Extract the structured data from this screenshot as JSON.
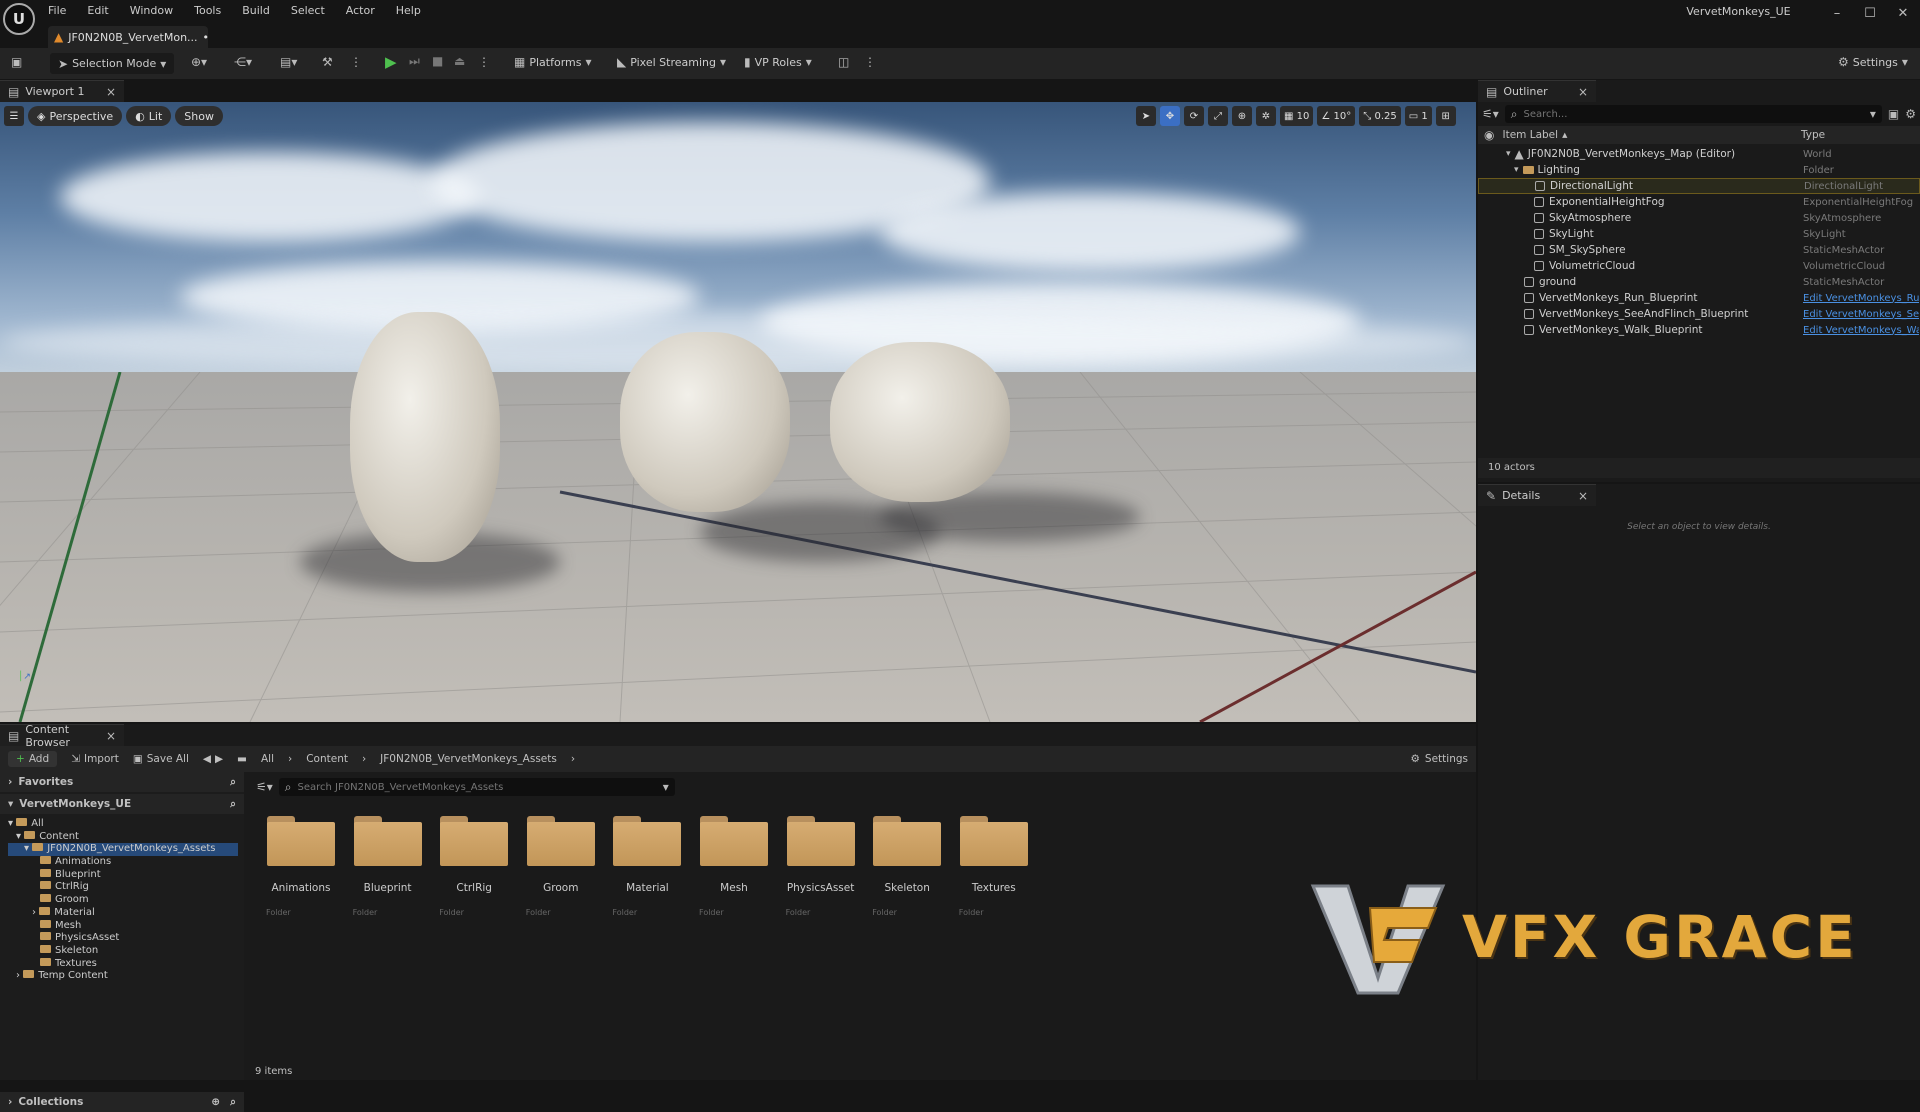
{
  "app": {
    "window_title": "VervetMonkeys_UE",
    "logo": "U",
    "doc_tab": "JF0N2N0B_VervetMon...",
    "doc_tab_dot": "•"
  },
  "menu": [
    "File",
    "Edit",
    "Window",
    "Tools",
    "Build",
    "Select",
    "Actor",
    "Help"
  ],
  "toolbar": {
    "selection_mode": "Selection Mode",
    "platforms": "Platforms",
    "pixel_streaming": "Pixel Streaming",
    "vp_roles": "VP Roles",
    "settings": "Settings"
  },
  "viewport": {
    "tab": "Viewport 1",
    "perspective": "Perspective",
    "lit": "Lit",
    "show": "Show",
    "grid_snap": "10",
    "rot_snap": "10°",
    "scale_snap": "0.25",
    "cam_speed": "1"
  },
  "outliner": {
    "tab": "Outliner",
    "search_placeholder": "Search...",
    "col_label": "Item Label",
    "col_type": "Type",
    "actor_count": "10 actors",
    "rows": [
      {
        "label": "JF0N2N0B_VervetMonkeys_Map (Editor)",
        "type": "World"
      },
      {
        "label": "Lighting",
        "type": "Folder"
      },
      {
        "label": "DirectionalLight",
        "type": "DirectionalLight"
      },
      {
        "label": "ExponentialHeightFog",
        "type": "ExponentialHeightFog"
      },
      {
        "label": "SkyAtmosphere",
        "type": "SkyAtmosphere"
      },
      {
        "label": "SkyLight",
        "type": "SkyLight"
      },
      {
        "label": "SM_SkySphere",
        "type": "StaticMeshActor"
      },
      {
        "label": "VolumetricCloud",
        "type": "VolumetricCloud"
      },
      {
        "label": "ground",
        "type": "StaticMeshActor"
      },
      {
        "label": "VervetMonkeys_Run_Blueprint",
        "type": "Edit VervetMonkeys_Rur"
      },
      {
        "label": "VervetMonkeys_SeeAndFlinch_Blueprint",
        "type": "Edit VervetMonkeys_See"
      },
      {
        "label": "VervetMonkeys_Walk_Blueprint",
        "type": "Edit VervetMonkeys_Wal"
      }
    ]
  },
  "details": {
    "tab": "Details",
    "empty_text": "Select an object to view details."
  },
  "content_browser": {
    "tab": "Content Browser",
    "add": "Add",
    "import": "Import",
    "save_all": "Save All",
    "crumb_all": "All",
    "crumb_content": "Content",
    "crumb_assets": "JF0N2N0B_VervetMonkeys_Assets",
    "settings": "Settings",
    "favorites": "Favorites",
    "project": "VervetMonkeys_UE",
    "collections": "Collections",
    "search_placeholder": "Search JF0N2N0B_VervetMonkeys_Assets",
    "item_count": "9 items",
    "tree": [
      "All",
      "Content",
      "JF0N2N0B_VervetMonkeys_Assets",
      "Animations",
      "Blueprint",
      "CtrlRig",
      "Groom",
      "Material",
      "Mesh",
      "PhysicsAsset",
      "Skeleton",
      "Textures",
      "Temp Content"
    ],
    "folders": [
      {
        "name": "Animations",
        "type": "Folder"
      },
      {
        "name": "Blueprint",
        "type": "Folder"
      },
      {
        "name": "CtrlRig",
        "type": "Folder"
      },
      {
        "name": "Groom",
        "type": "Folder"
      },
      {
        "name": "Material",
        "type": "Folder"
      },
      {
        "name": "Mesh",
        "type": "Folder"
      },
      {
        "name": "PhysicsAsset",
        "type": "Folder"
      },
      {
        "name": "Skeleton",
        "type": "Folder"
      },
      {
        "name": "Textures",
        "type": "Folder"
      }
    ]
  },
  "watermark": {
    "text": "VFX GRACE"
  }
}
